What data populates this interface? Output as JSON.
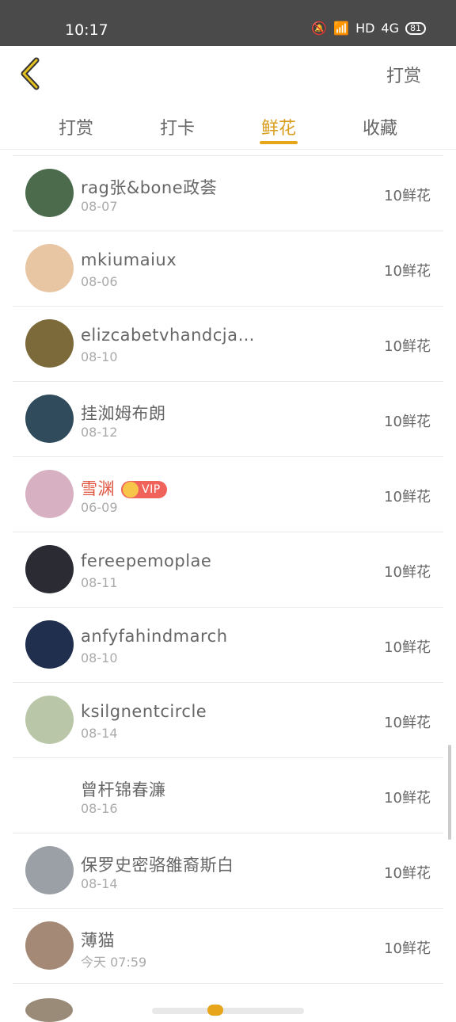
{
  "status": {
    "time": "10:17",
    "network": "HD",
    "signal": "4G",
    "battery": "81"
  },
  "header": {
    "action_label": "打赏"
  },
  "tabs": [
    {
      "label": "打赏"
    },
    {
      "label": "打卡"
    },
    {
      "label": "鲜花"
    },
    {
      "label": "收藏"
    }
  ],
  "active_tab": "鲜花",
  "rows": [
    {
      "name": "rag张&bone政荟",
      "date": "08-07",
      "amount": "10鲜花",
      "avatar_color": "#4b6b4c"
    },
    {
      "name": "mkiumaiux",
      "date": "08-06",
      "amount": "10鲜花",
      "avatar_color": "#e8c6a4"
    },
    {
      "name": "elizcabetvhandcja…",
      "date": "08-10",
      "amount": "10鲜花",
      "avatar_color": "#7d6a3a"
    },
    {
      "name": "挂洳姆布朗",
      "date": "08-12",
      "amount": "10鲜花",
      "avatar_color": "#2f4b5c"
    },
    {
      "name": "雪渊",
      "date": "06-09",
      "amount": "10鲜花",
      "avatar_color": "#d7b0c2",
      "vip": "VIP"
    },
    {
      "name": "fereepemoplae",
      "date": "08-11",
      "amount": "10鲜花",
      "avatar_color": "#2b2b33"
    },
    {
      "name": "anfyfahindmarch",
      "date": "08-10",
      "amount": "10鲜花",
      "avatar_color": "#1f2f4d"
    },
    {
      "name": "ksilgnentcircle",
      "date": "08-14",
      "amount": "10鲜花",
      "avatar_color": "#b9c7a8"
    },
    {
      "name": "曾杆锦春濂",
      "date": "08-16",
      "amount": "10鲜花",
      "avatar_color": ""
    },
    {
      "name": "保罗史密骆雒裔斯白",
      "date": "08-14",
      "amount": "10鲜花",
      "avatar_color": "#9aa0a6"
    },
    {
      "name": "薄猫",
      "date": "今天  07:59",
      "amount": "10鲜花",
      "avatar_color": "#a48a76"
    }
  ]
}
